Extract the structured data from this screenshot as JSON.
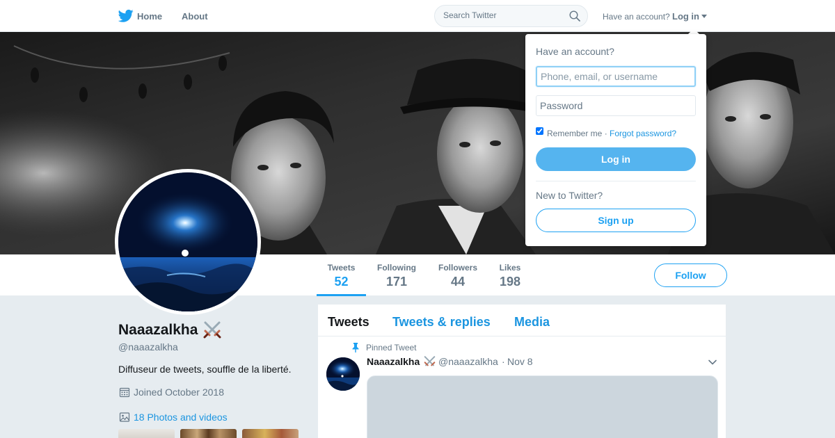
{
  "nav": {
    "home_label": "Home",
    "about_label": "About",
    "search_placeholder": "Search Twitter",
    "have_account": "Have an account?",
    "login_label": "Log in",
    "logo_icon": "twitter-bird-icon"
  },
  "profile": {
    "display_name": "Naaazalkha",
    "name_emoji_icon": "crossed-swords-icon",
    "handle": "@naaazalkha",
    "bio": "Diffuseur de tweets, souffle de la liberté.",
    "joined": "Joined October 2018",
    "photos_link": "18 Photos and videos",
    "follow_label": "Follow",
    "stats": [
      {
        "label": "Tweets",
        "value": "52",
        "active": true
      },
      {
        "label": "Following",
        "value": "171",
        "active": false
      },
      {
        "label": "Followers",
        "value": "44",
        "active": false
      },
      {
        "label": "Likes",
        "value": "198",
        "active": false
      }
    ]
  },
  "timeline": {
    "tabs": [
      "Tweets",
      "Tweets & replies",
      "Media"
    ],
    "active_tab": "Tweets",
    "pinned": {
      "label": "Pinned Tweet",
      "author": "Naaazalkha",
      "handle": "@naaazalkha",
      "separator": "·",
      "time": "Nov 8"
    }
  },
  "login_dropdown": {
    "title": "Have an account?",
    "username_placeholder": "Phone, email, or username",
    "password_placeholder": "Password",
    "remember_label": "Remember me ·",
    "forgot_link": "Forgot password?",
    "login_button": "Log in",
    "new_prompt": "New to Twitter?",
    "signup_button": "Sign up"
  },
  "colors": {
    "accent": "#1da1f2",
    "link": "#1b95e0",
    "background": "#e6ecf0",
    "muted_text": "#657786"
  }
}
